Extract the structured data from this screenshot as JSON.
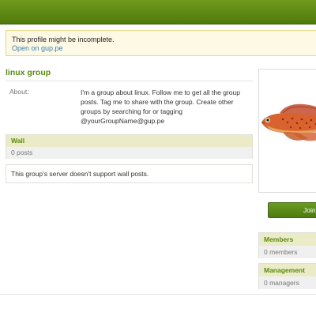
{
  "notice": {
    "message": "This profile might be incomplete.",
    "link": "Open on gup.pe"
  },
  "group": {
    "name": "linux group",
    "about_label": "About:",
    "about_text": "I'm a group about linux. Follow me to get all the group posts. Tag me to share with the group. Create other groups by searching for or tagging @yourGroupName@gup.pe"
  },
  "wall": {
    "heading": "Wall",
    "count": "0 posts",
    "message": "This group's server doesn't support wall posts."
  },
  "sidebar": {
    "join_label": "Join",
    "members_heading": "Members",
    "members_count": "0 members",
    "management_heading": "Management",
    "managers_count": "0 managers"
  },
  "colors": {
    "brand_green": "#5a8a10",
    "link_blue": "#3a7fb0",
    "notice_bg": "#fdf9e4"
  }
}
